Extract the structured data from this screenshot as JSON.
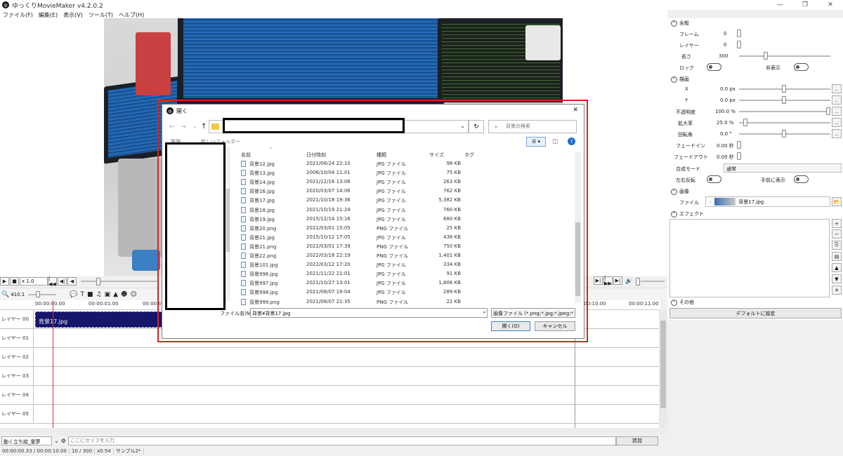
{
  "app": {
    "title": "ゆっくりMovieMaker v4.2.0.2",
    "logo": "ゆ",
    "minimize": "—",
    "maximize": "❐",
    "close": "✕"
  },
  "menu": [
    "ファイル(F)",
    "編集(E)",
    "表示(V)",
    "ツール(T)",
    "ヘルプ(H)"
  ],
  "transport": {
    "play": "▶",
    "stop": "■",
    "speed": "x 1.0",
    "prev_clip": "|◀◀",
    "prev_frame": "◀|",
    "back": "◀",
    "next_frame": "▶|",
    "skip_fwd": "|▶▶",
    "end": "▶|",
    "volume_icon": "🔊"
  },
  "tools": {
    "zoom_value": "410.1"
  },
  "ruler": [
    "00:00:00.00",
    "00:00:01.00",
    "00:00:0",
    "00:00:10.00",
    "00:00:11.00"
  ],
  "layers": [
    "レイヤー 00",
    "レイヤー 01",
    "レイヤー 02",
    "レイヤー 03",
    "レイヤー 04",
    "レイヤー 05"
  ],
  "clip": {
    "label": "背景17.jpg"
  },
  "input": {
    "character": "動く立ち絵_霊夢",
    "placeholder": "ここにセリフを入力",
    "add_button": "追加",
    "dropdown": "⌄"
  },
  "status": {
    "time": "00:00:00.33 / 00:00:10.00",
    "frames": "10 / 300",
    "zoom": "x0.54",
    "sample": "サンプル2*"
  },
  "right": {
    "general": {
      "header": "全般",
      "frame_label": "フレーム",
      "frame_value": "0",
      "layer_label": "レイヤー",
      "layer_value": "0",
      "length_label": "長さ",
      "length_value": "300",
      "lock_label": "ロック",
      "hide_label": "非表示"
    },
    "draw": {
      "header": "描画",
      "x_label": "X",
      "x_value": "0.0 px",
      "y_label": "Y",
      "y_value": "0.0 px",
      "opacity_label": "不透明度",
      "opacity_value": "100.0 %",
      "scale_label": "拡大率",
      "scale_value": "25.0 %",
      "rotate_label": "回転角",
      "rotate_value": "0.0 °",
      "fadein_label": "フェードイン",
      "fadein_value": "0.00 秒",
      "fadeout_label": "フェードアウト",
      "fadeout_value": "0.00 秒",
      "blend_label": "合成モード",
      "blend_value": "通常",
      "flip_label": "左右反転",
      "front_label": "手前に表示"
    },
    "image": {
      "header": "画像",
      "file_label": "ファイル",
      "file_value": "背景17.jpg"
    },
    "effect": {
      "header": "エフェクト"
    },
    "other": {
      "header": "その他",
      "default_button": "デフォルトに設定"
    }
  },
  "dialog": {
    "title": "開く",
    "search_placeholder": "背景の検索",
    "org_label": "整理",
    "new_folder": "新しいフォルダー",
    "columns": {
      "name": "名前",
      "date": "日付時刻",
      "type": "種類",
      "size": "サイズ",
      "tag": "タグ"
    },
    "files": [
      {
        "name": "背景12.jpg",
        "date": "2021/08/24 22:10",
        "type": "JPG ファイル",
        "size": "98 KB"
      },
      {
        "name": "背景13.jpg",
        "date": "2006/10/04 11:01",
        "type": "JPG ファイル",
        "size": "75 KB"
      },
      {
        "name": "背景14.jpg",
        "date": "2021/12/16 13:06",
        "type": "JPG ファイル",
        "size": "263 KB"
      },
      {
        "name": "背景16.jpg",
        "date": "2020/03/07 14:06",
        "type": "JPG ファイル",
        "size": "762 KB"
      },
      {
        "name": "背景17.jpg",
        "date": "2021/10/18 19:36",
        "type": "JPG ファイル",
        "size": "5,382 KB"
      },
      {
        "name": "背景18.jpg",
        "date": "2021/10/19 21:24",
        "type": "JPG ファイル",
        "size": "760 KB"
      },
      {
        "name": "背景19.jpg",
        "date": "2015/12/14 15:16",
        "type": "JPG ファイル",
        "size": "680 KB"
      },
      {
        "name": "背景20.png",
        "date": "2022/03/01 15:05",
        "type": "PNG ファイル",
        "size": "25 KB"
      },
      {
        "name": "背景21.jpg",
        "date": "2015/10/12 17:05",
        "type": "JPG ファイル",
        "size": "436 KB"
      },
      {
        "name": "背景21.png",
        "date": "2022/03/01 17:39",
        "type": "PNG ファイル",
        "size": "750 KB"
      },
      {
        "name": "背景22.png",
        "date": "2022/03/18 22:19",
        "type": "PNG ファイル",
        "size": "1,401 KB"
      },
      {
        "name": "背景101.jpg",
        "date": "2022/03/12 17:20",
        "type": "JPG ファイル",
        "size": "334 KB"
      },
      {
        "name": "背景996.jpg",
        "date": "2021/11/22 21:01",
        "type": "JPG ファイル",
        "size": "91 KB"
      },
      {
        "name": "背景997.jpg",
        "date": "2021/10/27 13:01",
        "type": "JPG ファイル",
        "size": "1,806 KB"
      },
      {
        "name": "背景998.jpg",
        "date": "2021/08/07 19:04",
        "type": "JPG ファイル",
        "size": "289 KB"
      },
      {
        "name": "背景999.png",
        "date": "2021/08/07 21:35",
        "type": "PNG ファイル",
        "size": "22 KB"
      }
    ],
    "filename_label": "ファイル名(N):",
    "filename_value": "背景¥背景17.jpg",
    "filter": "画像ファイル (*.png;*.jpg;*.jpeg;*",
    "open_button": "開く(O)",
    "cancel_button": "キャンセル"
  },
  "colors": {
    "clip": "#15156b",
    "highlight": "#e02020",
    "playhead": "#e03030"
  }
}
